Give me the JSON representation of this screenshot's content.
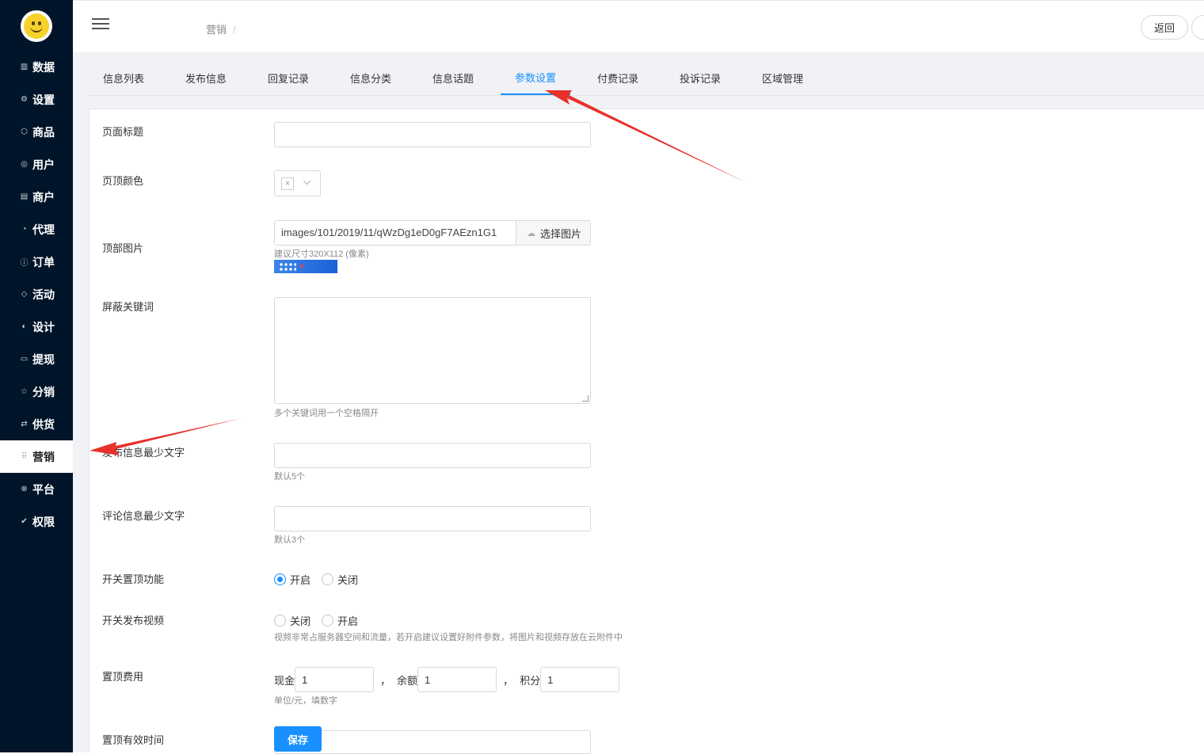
{
  "sidebar": {
    "items": [
      {
        "label": "数据",
        "icon": "bar-chart-icon"
      },
      {
        "label": "设置",
        "icon": "gear-icon"
      },
      {
        "label": "商品",
        "icon": "box-icon"
      },
      {
        "label": "用户",
        "icon": "user-icon"
      },
      {
        "label": "商户",
        "icon": "store-icon"
      },
      {
        "label": "代理",
        "icon": "pie-icon"
      },
      {
        "label": "订单",
        "icon": "info-icon"
      },
      {
        "label": "活动",
        "icon": "tag-icon"
      },
      {
        "label": "设计",
        "icon": "palette-icon"
      },
      {
        "label": "提现",
        "icon": "card-icon"
      },
      {
        "label": "分销",
        "icon": "star-icon"
      },
      {
        "label": "供货",
        "icon": "swap-icon"
      },
      {
        "label": "营销",
        "icon": "grid-icon"
      },
      {
        "label": "平台",
        "icon": "platform-icon"
      },
      {
        "label": "权限",
        "icon": "check-circle-icon"
      }
    ],
    "active_index": 12
  },
  "header": {
    "breadcrumb": "营销",
    "breadcrumb_sep": "/",
    "back_label": "返回"
  },
  "tabs": [
    "信息列表",
    "发布信息",
    "回复记录",
    "信息分类",
    "信息话题",
    "参数设置",
    "付费记录",
    "投诉记录",
    "区域管理"
  ],
  "active_tab": "参数设置",
  "form": {
    "page_title": {
      "label": "页面标题",
      "value": ""
    },
    "header_color": {
      "label": "页顶颜色",
      "value": "×"
    },
    "header_image": {
      "label": "顶部图片",
      "value": "images/101/2019/11/qWzDg1eD0gF7AEzn1G1",
      "button": "选择图片",
      "help": "建议尺寸320X112 (像素)"
    },
    "blocked_keywords": {
      "label": "屏蔽关键词",
      "value": "",
      "help": "多个关键词用一个空格隔开"
    },
    "min_post_chars": {
      "label": "发布信息最少文字",
      "value": "",
      "help": "默认5个"
    },
    "min_comment_chars": {
      "label": "评论信息最少文字",
      "value": "",
      "help": "默认3个"
    },
    "pin_feature": {
      "label": "开关置顶功能",
      "options": [
        "开启",
        "关闭"
      ],
      "selected": "开启"
    },
    "video_post": {
      "label": "开关发布视频",
      "options": [
        "关闭",
        "开启"
      ],
      "selected": "",
      "help": "视频非常占服务器空间和流量，若开启建议设置好附件参数，将图片和视频存放在云附件中"
    },
    "pin_fee": {
      "label": "置顶费用",
      "cash_label": "现金",
      "cash": "1",
      "sep": "，",
      "balance_label": "余额",
      "balance": "1",
      "points_label": "积分",
      "points": "1",
      "help": "单位/元，填数字"
    },
    "pin_duration": {
      "label": "置顶有效时间",
      "value": ""
    },
    "save_label": "保存"
  },
  "colors": {
    "sidebar_bg": "#001529",
    "accent": "#1890ff",
    "arrow": "#e8302c"
  }
}
